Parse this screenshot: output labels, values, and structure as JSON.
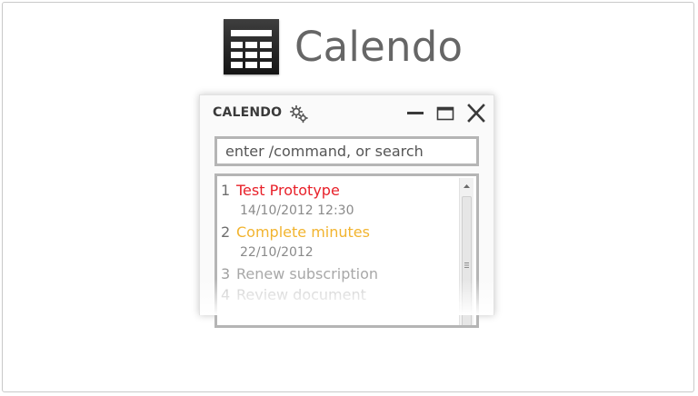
{
  "brand": {
    "title": "Calendo"
  },
  "window": {
    "title": "CALENDO",
    "icons": {
      "settings": "gears-icon",
      "minimize": "minimize-icon",
      "maximize": "maximize-icon",
      "close": "close-icon"
    }
  },
  "search": {
    "placeholder": "enter /command, or search",
    "value": ""
  },
  "tasks": [
    {
      "num": "1",
      "label": "Test Prototype",
      "date": "14/10/2012 12:30",
      "color": "#e8212a"
    },
    {
      "num": "2",
      "label": "Complete minutes",
      "date": "22/10/2012",
      "color": "#f2b42f"
    },
    {
      "num": "3",
      "label": "Renew subscription",
      "color": "#a8a8a8"
    },
    {
      "num": "4",
      "label": "Review document",
      "color": "#c8c8c8"
    }
  ],
  "colors": {
    "accent_red": "#e8212a",
    "accent_amber": "#f2b42f",
    "muted": "#a8a8a8"
  }
}
